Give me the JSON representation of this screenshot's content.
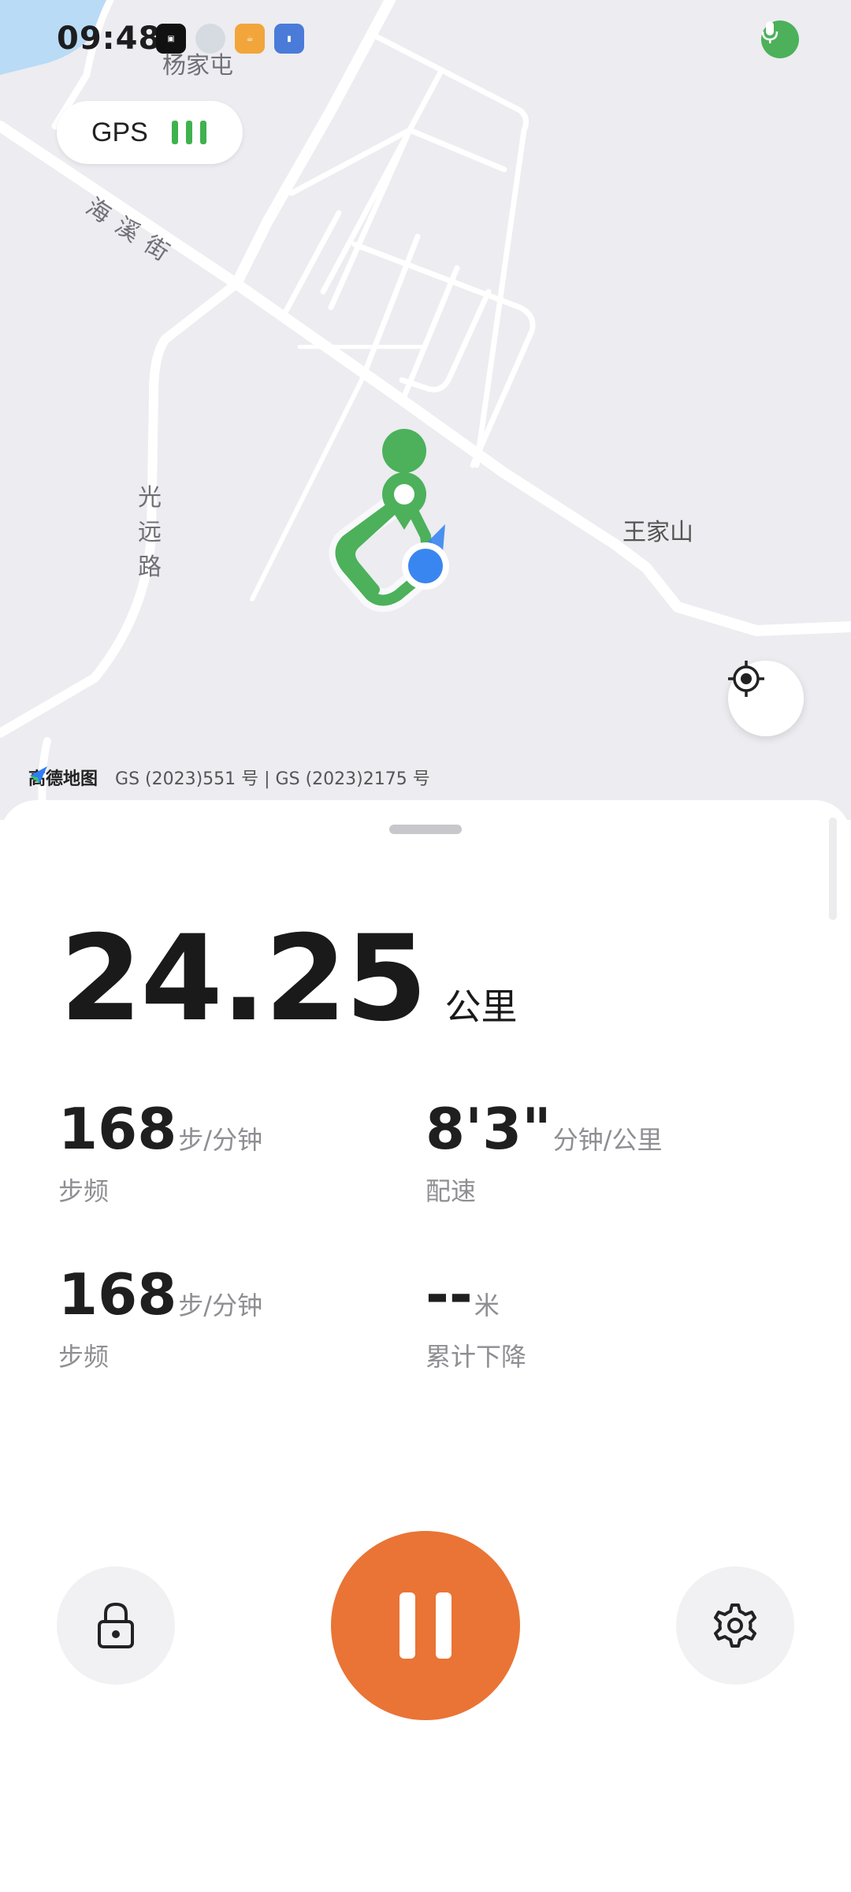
{
  "status": {
    "time": "09:48"
  },
  "map": {
    "gps_label": "GPS",
    "labels": {
      "village_north": "杨家屯",
      "street": "海溪街",
      "road": "光远路",
      "village_east": "王家山"
    },
    "attribution": {
      "logo_text": "高德地图",
      "license": "GS (2023)551 号 | GS (2023)2175 号"
    }
  },
  "workout": {
    "distance": {
      "value": "24.25",
      "unit": "公里"
    },
    "stats": [
      {
        "value": "168",
        "unit": "步/分钟",
        "label": "步频"
      },
      {
        "value": "8'3\"",
        "unit": "分钟/公里",
        "label": "配速"
      },
      {
        "value": "168",
        "unit": "步/分钟",
        "label": "步频"
      },
      {
        "value": "--",
        "unit": "米",
        "label": "累计下降"
      }
    ]
  },
  "colors": {
    "accent": "#e97435",
    "route": "#4cb15a",
    "gps": "#3fb24e",
    "position": "#3a86f0"
  },
  "icons": {
    "mic": "microphone-icon",
    "locate": "locate-icon",
    "lock": "lock-icon",
    "pause": "pause-icon",
    "settings": "gear-icon"
  }
}
